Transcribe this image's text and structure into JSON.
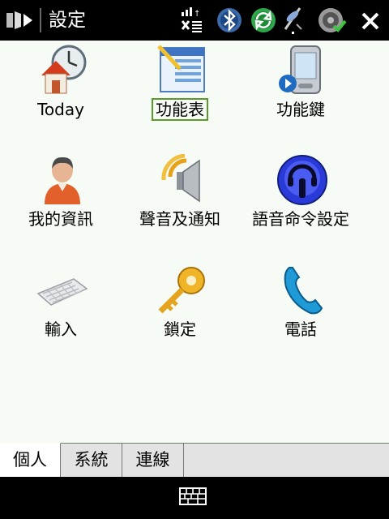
{
  "title_bar": {
    "title": "設定"
  },
  "items": [
    {
      "label": "Today",
      "icon": "today-clock-house-icon"
    },
    {
      "label": "功能表",
      "icon": "menu-window-icon"
    },
    {
      "label": "功能鍵",
      "icon": "buttons-device-icon"
    },
    {
      "label": "我的資訊",
      "icon": "owner-person-icon"
    },
    {
      "label": "聲音及通知",
      "icon": "speaker-icon"
    },
    {
      "label": "語音命令設定",
      "icon": "voice-command-icon"
    },
    {
      "label": "輸入",
      "icon": "keyboard-icon"
    },
    {
      "label": "鎖定",
      "icon": "key-icon"
    },
    {
      "label": "電話",
      "icon": "phone-icon"
    }
  ],
  "tabs": [
    {
      "label": "個人"
    },
    {
      "label": "系統"
    },
    {
      "label": "連線"
    }
  ]
}
